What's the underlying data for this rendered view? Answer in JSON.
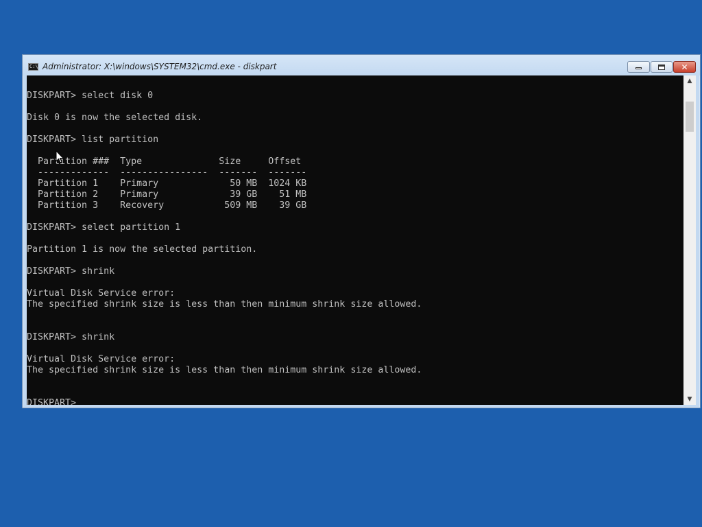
{
  "window": {
    "title": "Administrator: X:\\windows\\SYSTEM32\\cmd.exe - diskpart",
    "icon": "cmd-icon",
    "icon_glyph": "C:\\"
  },
  "controls": {
    "minimize": "minimize-icon",
    "maximize": "maximize-icon",
    "close": "close-icon",
    "close_glyph": "✕"
  },
  "scrollbar": {
    "up_glyph": "▲",
    "down_glyph": "▼"
  },
  "console": {
    "lines": [
      "DISKPART> select disk 0",
      "",
      "Disk 0 is now the selected disk.",
      "",
      "DISKPART> list partition",
      "",
      "  Partition ###  Type              Size     Offset",
      "  -------------  ----------------  -------  -------",
      "  Partition 1    Primary             50 MB  1024 KB",
      "  Partition 2    Primary             39 GB    51 MB",
      "  Partition 3    Recovery           509 MB    39 GB",
      "",
      "DISKPART> select partition 1",
      "",
      "Partition 1 is now the selected partition.",
      "",
      "DISKPART> shrink",
      "",
      "Virtual Disk Service error:",
      "The specified shrink size is less than then minimum shrink size allowed.",
      "",
      "",
      "DISKPART> shrink",
      "",
      "Virtual Disk Service error:",
      "The specified shrink size is less than then minimum shrink size allowed.",
      "",
      "",
      "DISKPART> "
    ]
  },
  "colors": {
    "desktop": "#1d5fae",
    "console_bg": "#0c0c0c",
    "console_fg": "#c0c0c0"
  }
}
